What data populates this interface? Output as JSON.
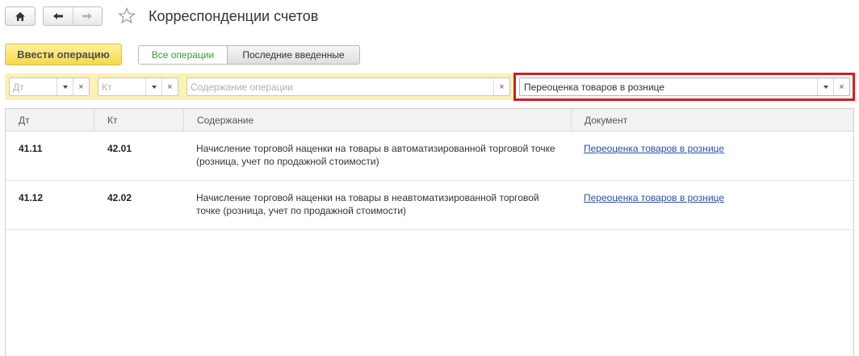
{
  "header": {
    "title": "Корреспонденции счетов"
  },
  "toolbar": {
    "primary_label": "Ввести операцию",
    "toggle_all_label": "Все операции",
    "toggle_recent_label": "Последние введенные"
  },
  "filters": {
    "dt_placeholder": "Дт",
    "kt_placeholder": "Кт",
    "content_placeholder": "Содержание операции",
    "document_value": "Переоценка товаров в рознице"
  },
  "table": {
    "columns": [
      "Дт",
      "Кт",
      "Содержание",
      "Документ"
    ],
    "rows": [
      {
        "dt": "41.11",
        "kt": "42.01",
        "content": "Начисление торговой наценки на товары в автоматизированной торговой точке (розница, учет по продажной стоимости)",
        "document": "Переоценка товаров в рознице"
      },
      {
        "dt": "41.12",
        "kt": "42.02",
        "content": "Начисление торговой наценки на товары в неавтоматизированной торговой точке (розница, учет по продажной стоимости)",
        "document": "Переоценка товаров в рознице"
      }
    ]
  },
  "colors": {
    "accent_yellow": "#f5d94a",
    "filter_bar": "#fbf1b3",
    "highlight_border": "#d12020",
    "link": "#2a4fa8",
    "toggle_active_text": "#3a9a3a"
  }
}
